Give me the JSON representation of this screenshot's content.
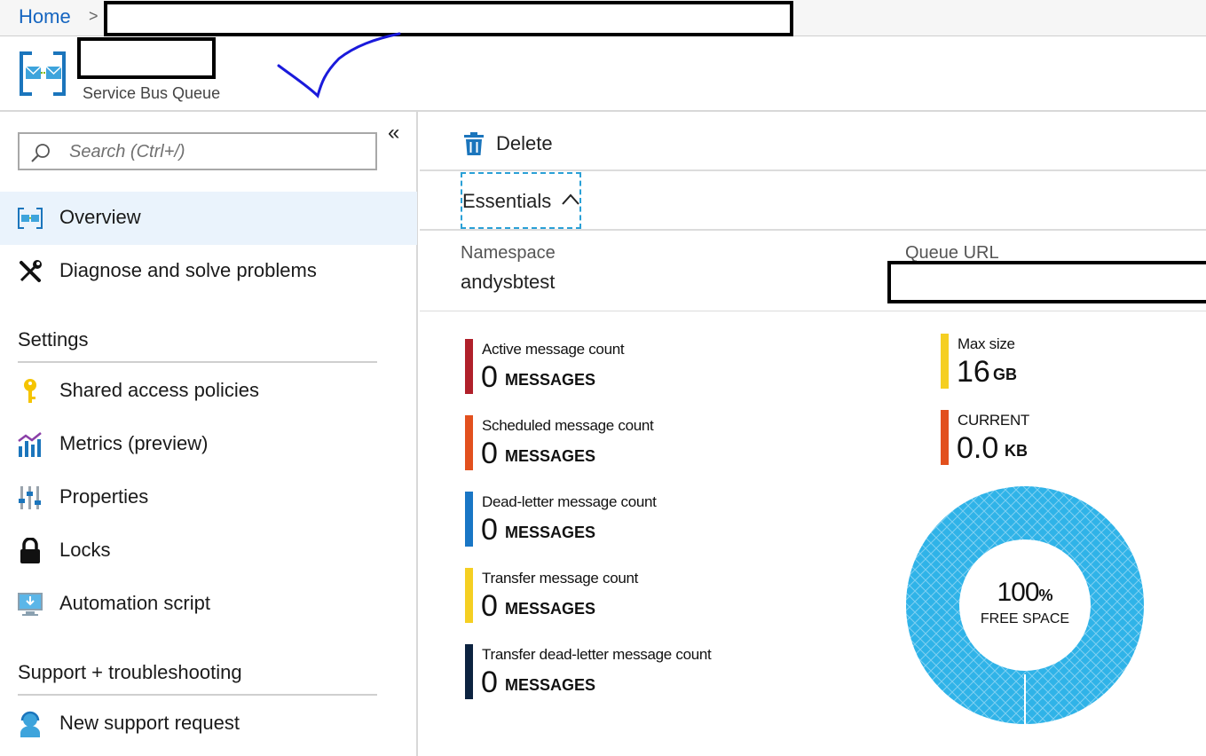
{
  "breadcrumb": {
    "home": "Home",
    "separator": ">"
  },
  "resource": {
    "type": "Service Bus Queue"
  },
  "sidebar": {
    "collapse_glyph": "«",
    "search_placeholder": "Search (Ctrl+/)",
    "items": [
      {
        "label": "Overview",
        "icon": "service-bus-queue-icon",
        "active": true
      },
      {
        "label": "Diagnose and solve problems",
        "icon": "wrench-screwdriver-icon"
      }
    ],
    "sections": [
      {
        "title": "Settings",
        "items": [
          {
            "label": "Shared access policies",
            "icon": "key-icon"
          },
          {
            "label": "Metrics (preview)",
            "icon": "metrics-chart-icon"
          },
          {
            "label": "Properties",
            "icon": "properties-sliders-icon"
          },
          {
            "label": "Locks",
            "icon": "lock-icon"
          },
          {
            "label": "Automation script",
            "icon": "automation-download-icon"
          }
        ]
      },
      {
        "title": "Support + troubleshooting",
        "items": [
          {
            "label": "New support request",
            "icon": "support-person-icon"
          }
        ]
      }
    ]
  },
  "toolbar": {
    "delete_label": "Delete"
  },
  "essentials": {
    "label": "Essentials",
    "namespace_label": "Namespace",
    "namespace_value": "andysbtest",
    "queue_url_label": "Queue URL"
  },
  "metrics": [
    {
      "title": "Active message count",
      "value": "0",
      "unit": "MESSAGES",
      "color": "#b0202a"
    },
    {
      "title": "Scheduled message count",
      "value": "0",
      "unit": "MESSAGES",
      "color": "#e2501e"
    },
    {
      "title": "Dead-letter message count",
      "value": "0",
      "unit": "MESSAGES",
      "color": "#1976c5"
    },
    {
      "title": "Transfer message count",
      "value": "0",
      "unit": "MESSAGES",
      "color": "#f5cf22"
    },
    {
      "title": "Transfer dead-letter message count",
      "value": "0",
      "unit": "MESSAGES",
      "color": "#0c2340"
    }
  ],
  "size": [
    {
      "title": "Max size",
      "value": "16",
      "unit": "GB",
      "color": "#f5cf22"
    },
    {
      "title": "CURRENT",
      "value": "0.0",
      "unit": "KB",
      "color": "#e2501e"
    }
  ],
  "donut": {
    "value": "100",
    "unit": "%",
    "label": "FREE SPACE",
    "free_fraction": 1.0,
    "color": "#2fb3e8"
  }
}
